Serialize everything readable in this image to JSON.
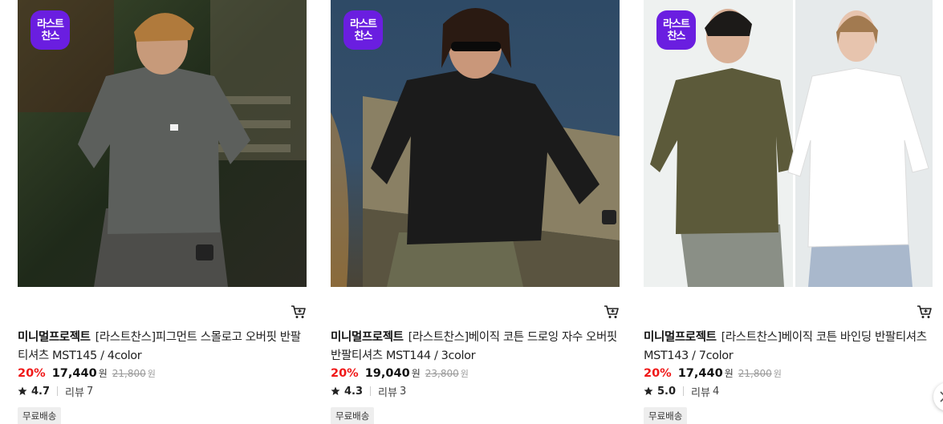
{
  "products": [
    {
      "badge_line1": "라스트",
      "badge_line2": "찬스",
      "brand": "미니멀프로젝트",
      "name": "[라스트찬스]피그먼트 스몰로고 오버핏 반팔티셔츠 MST145 / 4color",
      "discount": "20%",
      "price": "17,440",
      "currency": "원",
      "original_price": "21,800",
      "original_currency": "원",
      "rating": "4.7",
      "review_label": "리뷰",
      "review_count": "7",
      "tag": "무료배송",
      "image_icon": "product-photo-gray-tshirt"
    },
    {
      "badge_line1": "라스트",
      "badge_line2": "찬스",
      "brand": "미니멀프로젝트",
      "name": "[라스트찬스]베이직 코튼 드로잉 자수 오버핏 반팔티셔츠 MST144 / 3color",
      "discount": "20%",
      "price": "19,040",
      "currency": "원",
      "original_price": "23,800",
      "original_currency": "원",
      "rating": "4.3",
      "review_label": "리뷰",
      "review_count": "3",
      "tag": "무료배송",
      "image_icon": "product-photo-black-tshirt"
    },
    {
      "badge_line1": "라스트",
      "badge_line2": "찬스",
      "brand": "미니멀프로젝트",
      "name": "[라스트찬스]베이직 코튼 바인딩 반팔티셔츠 MST143 / 7color",
      "discount": "20%",
      "price": "17,440",
      "currency": "원",
      "original_price": "21,800",
      "original_currency": "원",
      "rating": "5.0",
      "review_label": "리뷰",
      "review_count": "4",
      "tag": "무료배송",
      "image_icon": "product-photo-olive-white-tshirt"
    }
  ],
  "colors": {
    "badge": "#6a1ee0",
    "discount": "#f01818",
    "strike": "#999999",
    "tag_bg": "#eeeeee"
  },
  "icons": {
    "cart": "cart-icon",
    "star": "star-icon",
    "next": "chevron-right-icon"
  }
}
